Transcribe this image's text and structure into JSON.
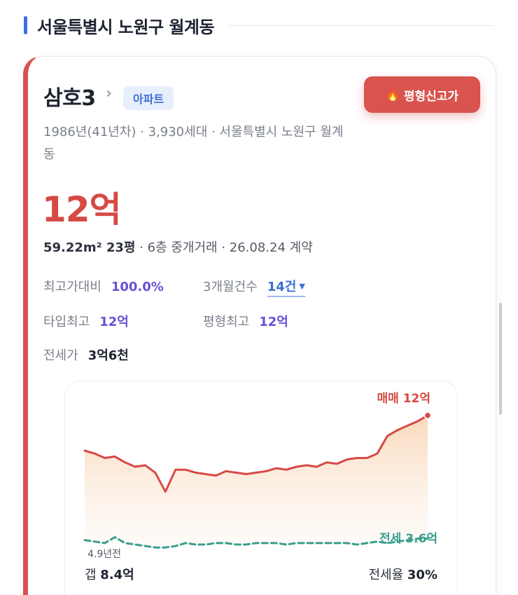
{
  "section": {
    "title": "서울특별시 노원구 월계동"
  },
  "card": {
    "name": "삼호3",
    "type_badge": "아파트",
    "hot_badge": "평형신고가",
    "desc": "1986년(41년차) · 3,930세대 · 서울특별시 노원구 월계동",
    "price": "12억",
    "deal": {
      "area": "59.22m² 23평",
      "rest": " · 6층 중개거래 · 26.08.24 계약"
    },
    "stats": {
      "max_ratio_label": "최고가대비",
      "max_ratio_value": "100.0%",
      "count_label": "3개월건수",
      "count_value": "14건",
      "type_max_label": "타입최고",
      "type_max_value": "12억",
      "size_max_label": "평형최고",
      "size_max_value": "12억",
      "jeonse_label": "전세가",
      "jeonse_value": "3억6천"
    }
  },
  "chart": {
    "sale_label": "매매 12억",
    "rent_label": "전세 3.6억",
    "years_ago": "4.9년전",
    "gap_label": "갭",
    "gap_value": "8.4억",
    "ratio_label": "전세율",
    "ratio_value": "30%"
  },
  "chart_data": {
    "type": "line",
    "series": [
      {
        "name": "매매",
        "color": "#d64a44",
        "values": [
          9.6,
          9.4,
          9.1,
          9.2,
          8.8,
          8.5,
          8.6,
          8.1,
          6.8,
          8.3,
          8.3,
          8.1,
          8.0,
          7.9,
          8.2,
          8.1,
          8.0,
          8.1,
          8.2,
          8.4,
          8.3,
          8.5,
          8.6,
          8.5,
          8.8,
          8.7,
          9.0,
          9.1,
          9.1,
          9.4,
          10.6,
          11.0,
          11.3,
          11.6,
          12.0
        ]
      },
      {
        "name": "전세",
        "color": "#3a9e8c",
        "values": [
          3.5,
          3.4,
          3.3,
          3.7,
          3.3,
          3.2,
          3.1,
          3.0,
          3.0,
          3.1,
          3.3,
          3.2,
          3.2,
          3.3,
          3.3,
          3.2,
          3.2,
          3.3,
          3.3,
          3.3,
          3.2,
          3.3,
          3.3,
          3.3,
          3.3,
          3.3,
          3.3,
          3.2,
          3.3,
          3.4,
          3.3,
          3.4,
          3.5,
          3.6,
          3.6
        ]
      }
    ]
  }
}
